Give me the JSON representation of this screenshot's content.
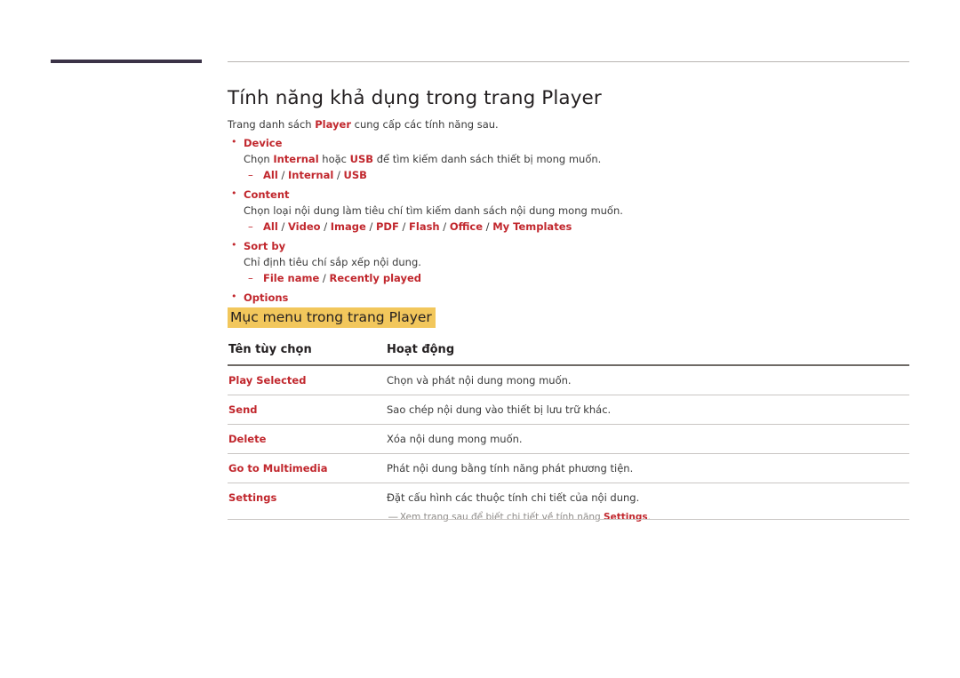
{
  "title": "Tính năng khả dụng trong trang Player",
  "intro": {
    "before": "Trang danh sách ",
    "keyword": "Player",
    "after": " cung cấp các tính năng sau."
  },
  "bullets": [
    {
      "head": "Device",
      "desc_before": "Chọn ",
      "desc_kw1": "Internal",
      "desc_mid": " hoặc ",
      "desc_kw2": "USB",
      "desc_after": " để tìm kiếm danh sách thiết bị mong muốn.",
      "sub": "All / Internal / USB"
    },
    {
      "head": "Content",
      "desc": "Chọn loại nội dung làm tiêu chí tìm kiếm danh sách nội dung mong muốn.",
      "sub": "All / Video / Image / PDF / Flash / Office / My Templates"
    },
    {
      "head": "Sort by",
      "desc": "Chỉ định tiêu chí sắp xếp nội dung.",
      "sub": "File name / Recently played"
    },
    {
      "head": "Options",
      "desc": "",
      "sub": ""
    }
  ],
  "section_heading": "Mục menu trong trang Player",
  "table": {
    "headers": [
      "Tên tùy chọn",
      "Hoạt động"
    ],
    "rows": [
      {
        "option": "Play Selected",
        "action": "Chọn và phát nội dung mong muốn."
      },
      {
        "option": "Send",
        "action": "Sao chép nội dung vào thiết bị lưu trữ khác."
      },
      {
        "option": "Delete",
        "action": "Xóa nội dung mong muốn."
      },
      {
        "option": "Go to Multimedia",
        "action": "Phát nội dung bằng tính năng phát phương tiện."
      },
      {
        "option": "Settings",
        "action": "Đặt cấu hình các thuộc tính chi tiết của nội dung."
      }
    ],
    "note": {
      "dash": "―",
      "before": " Xem trang sau để biết chi tiết về tính năng ",
      "keyword": "Settings",
      "after": "."
    }
  },
  "colors": {
    "accent_red": "#c1272d",
    "highlight_yellow": "#f2c75c",
    "rule_dark": "#3b3347",
    "body_text": "#3a3a3a"
  }
}
